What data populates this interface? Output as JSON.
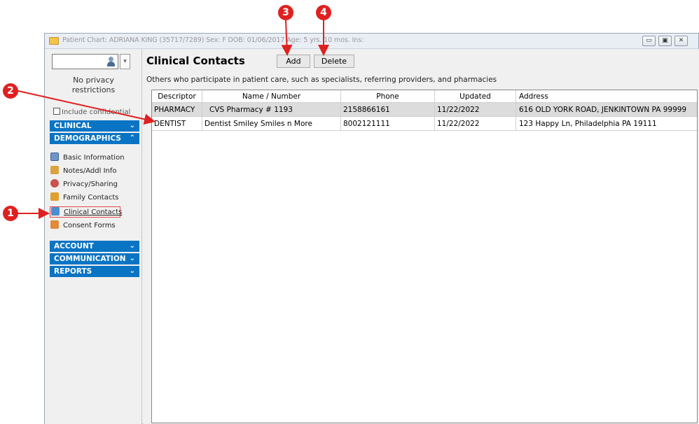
{
  "window": {
    "title": "Patient Chart: ADRIANA KING (35717/7289)  Sex: F  DOB: 01/06/2017  Age: 5 yrs. 10 mos.  Ins:",
    "controls": [
      "▭",
      "▣",
      "✕"
    ]
  },
  "sidebar": {
    "privacy_line1": "No privacy",
    "privacy_line2": "restrictions",
    "include_confidential": "Include confidential",
    "sections": {
      "clinical": "CLINICAL",
      "demographics": "DEMOGRAPHICS",
      "account": "ACCOUNT",
      "communication": "COMMUNICATION",
      "reports": "REPORTS"
    },
    "demographics_items": [
      {
        "label": "Basic Information",
        "icon": "id-card-icon"
      },
      {
        "label": "Notes/Addl Info",
        "icon": "notes-icon"
      },
      {
        "label": "Privacy/Sharing",
        "icon": "privacy-icon"
      },
      {
        "label": "Family Contacts",
        "icon": "family-icon"
      },
      {
        "label": "Clinical Contacts",
        "icon": "clinical-contacts-icon"
      },
      {
        "label": "Consent Forms",
        "icon": "consent-icon"
      }
    ]
  },
  "main": {
    "title": "Clinical Contacts",
    "add_label": "Add",
    "delete_label": "Delete",
    "description": "Others who participate in patient care, such as specialists, referring providers, and pharmacies",
    "columns": [
      "Descriptor",
      "Name / Number",
      "Phone",
      "Updated",
      "Address"
    ],
    "rows": [
      [
        "PHARMACY",
        "CVS Pharmacy # 1193",
        "2158866161",
        "11/22/2022",
        "616 OLD YORK ROAD, JENKINTOWN PA 99999"
      ],
      [
        "DENTIST",
        "Dentist Smiley Smiles n More",
        "8002121111",
        "11/22/2022",
        "123 Happy Ln, Philadelphia PA 19111"
      ]
    ]
  },
  "callouts": [
    "1",
    "2",
    "3",
    "4"
  ],
  "colors": {
    "section_header": "#0a74c4",
    "callout": "#e02020",
    "selected_row": "#dcdcdc"
  }
}
